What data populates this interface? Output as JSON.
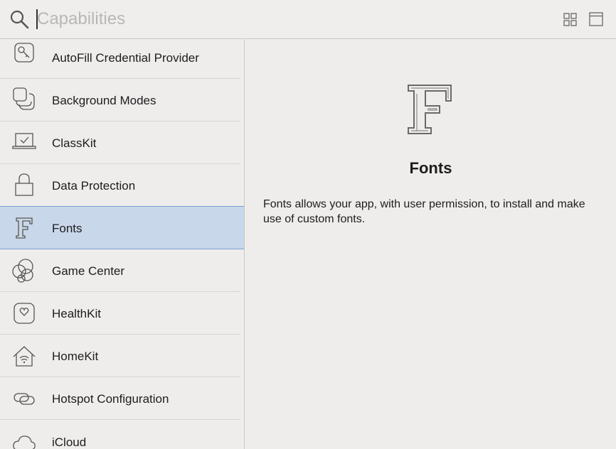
{
  "search": {
    "placeholder": "Capabilities",
    "value": ""
  },
  "toolbar": {
    "grid_icon": "grid-view-icon",
    "panel_icon": "panel-view-icon"
  },
  "capabilities": [
    {
      "label": "AutoFill Credential Provider",
      "icon": "key-icon"
    },
    {
      "label": "Background Modes",
      "icon": "layers-icon"
    },
    {
      "label": "ClassKit",
      "icon": "classkit-icon"
    },
    {
      "label": "Data Protection",
      "icon": "lock-icon"
    },
    {
      "label": "Fonts",
      "icon": "font-icon",
      "selected": true
    },
    {
      "label": "Game Center",
      "icon": "game-center-icon"
    },
    {
      "label": "HealthKit",
      "icon": "heart-icon"
    },
    {
      "label": "HomeKit",
      "icon": "home-icon"
    },
    {
      "label": "Hotspot Configuration",
      "icon": "hotspot-icon"
    },
    {
      "label": "iCloud",
      "icon": "cloud-icon"
    }
  ],
  "detail": {
    "title": "Fonts",
    "description": "Fonts allows your app, with user permission, to install and make use of custom fonts.",
    "icon": "font-icon"
  },
  "colors": {
    "selection_bg": "#c9d7ea",
    "selection_border": "#7c9fd3",
    "background": "#efedeb"
  }
}
